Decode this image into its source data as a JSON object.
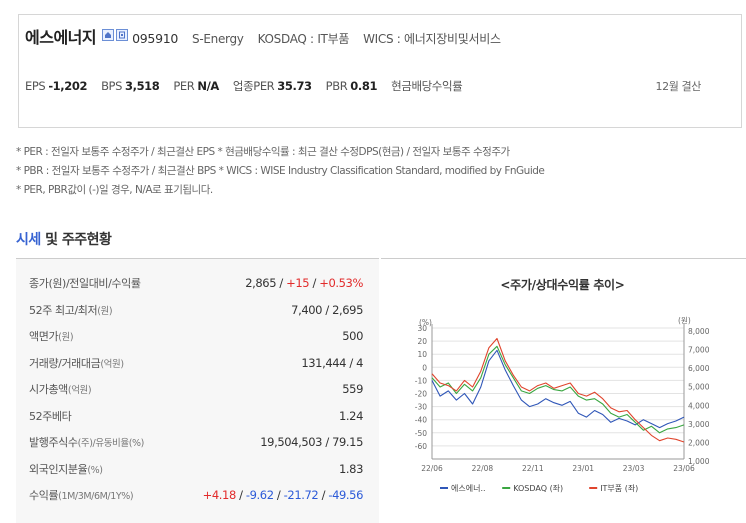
{
  "header": {
    "company_name": "에스에너지",
    "code": "095910",
    "english_name": "S-Energy",
    "market": "KOSDAQ : IT부품",
    "wics": "WICS : 에너지장비및서비스",
    "badge_icons": [
      "home-icon",
      "building-icon"
    ]
  },
  "metrics": [
    {
      "label": "EPS",
      "value": "-1,202"
    },
    {
      "label": "BPS",
      "value": "3,518"
    },
    {
      "label": "PER",
      "value": "N/A"
    },
    {
      "label": "업종PER",
      "value": "35.73"
    },
    {
      "label": "PBR",
      "value": "0.81"
    },
    {
      "label": "현금배당수익률",
      "value": ""
    }
  ],
  "settlement": "12월 결산",
  "notes": [
    "* PER : 전일자 보통주 수정주가 / 최근결산 EPS * 현금배당수익률 : 최근 결산 수정DPS(현금) / 전일자 보통주 수정주가",
    "* PBR : 전일자 보통주 수정주가 / 최근결산 BPS * WICS : WISE Industry Classification Standard, modified by FnGuide",
    "* PER, PBR값이 (-)일 경우, N/A로 표기됩니다."
  ],
  "section_title": {
    "accent": "시세",
    "rest": " 및 주주현황"
  },
  "table": [
    {
      "label": "종가(원)/전일대비/수익률",
      "unit": "",
      "value": "",
      "parts": [
        {
          "t": "2,865",
          "c": ""
        },
        {
          "t": " / ",
          "c": ""
        },
        {
          "t": "+15",
          "c": "up"
        },
        {
          "t": " / ",
          "c": ""
        },
        {
          "t": "+0.53%",
          "c": "up"
        }
      ]
    },
    {
      "label": "52주 최고/최저",
      "unit": "(원)",
      "value": "7,400 / 2,695"
    },
    {
      "label": "액면가",
      "unit": "(원)",
      "value": "500"
    },
    {
      "label": "거래량/거래대금",
      "unit": "(억원)",
      "value": "131,444 / 4"
    },
    {
      "label": "시가총액",
      "unit": "(억원)",
      "value": "559"
    },
    {
      "label": "52주베타",
      "unit": "",
      "value": "1.24"
    },
    {
      "label": "발행주식수",
      "unit": "(주)/유동비율(%)",
      "value": "19,504,503 / 79.15"
    },
    {
      "label": "외국인지분율",
      "unit": "(%)",
      "value": "1.83"
    },
    {
      "label": "수익률",
      "unit": "(1M/3M/6M/1Y%)",
      "value": "",
      "parts": [
        {
          "t": "+4.18",
          "c": "up"
        },
        {
          "t": " / ",
          "c": ""
        },
        {
          "t": "-9.62",
          "c": "down"
        },
        {
          "t": " / ",
          "c": ""
        },
        {
          "t": "-21.72",
          "c": "down"
        },
        {
          "t": " / ",
          "c": ""
        },
        {
          "t": "-49.56",
          "c": "down"
        }
      ]
    }
  ],
  "chart_data": {
    "type": "line",
    "title": "<주가/상대수익률 추이>",
    "y_left_unit": "(%)",
    "y_right_unit": "(원)",
    "y_left_ticks": [
      "30",
      "20",
      "10",
      "0",
      "-10",
      "-20",
      "-30",
      "-40",
      "-50",
      "-60"
    ],
    "y_left_range": [
      -70,
      30
    ],
    "y_right_ticks": [
      "8,000",
      "7,000",
      "6,000",
      "5,000",
      "4,000",
      "3,000",
      "2,000",
      "1,000"
    ],
    "y_right_range": [
      1000,
      8000
    ],
    "x_ticks": [
      "22/06",
      "22/08",
      "22/11",
      "23/01",
      "23/03",
      "23/06"
    ],
    "series": [
      {
        "name": "에스에너..",
        "color": "#3057b8",
        "axis": "left",
        "values": [
          -10,
          -22,
          -18,
          -25,
          -20,
          -28,
          -15,
          5,
          13,
          -2,
          -14,
          -25,
          -30,
          -28,
          -24,
          -27,
          -29,
          -26,
          -35,
          -38,
          -33,
          -36,
          -42,
          -39,
          -41,
          -44,
          -40,
          -43,
          -46,
          -43,
          -41,
          -38
        ]
      },
      {
        "name": "KOSDAQ (좌)",
        "color": "#3aa641",
        "axis": "left",
        "values": [
          -8,
          -15,
          -12,
          -20,
          -13,
          -18,
          -8,
          10,
          16,
          2,
          -8,
          -18,
          -20,
          -16,
          -14,
          -17,
          -18,
          -15,
          -22,
          -25,
          -24,
          -28,
          -35,
          -38,
          -36,
          -42,
          -48,
          -45,
          -50,
          -47,
          -46,
          -44
        ]
      },
      {
        "name": "IT부품 (좌)",
        "color": "#e0452d",
        "axis": "left",
        "values": [
          -5,
          -12,
          -14,
          -18,
          -10,
          -15,
          -3,
          15,
          22,
          5,
          -6,
          -15,
          -18,
          -14,
          -12,
          -16,
          -14,
          -12,
          -20,
          -22,
          -19,
          -24,
          -31,
          -34,
          -33,
          -40,
          -46,
          -52,
          -56,
          -54,
          -55,
          -57
        ]
      }
    ]
  }
}
